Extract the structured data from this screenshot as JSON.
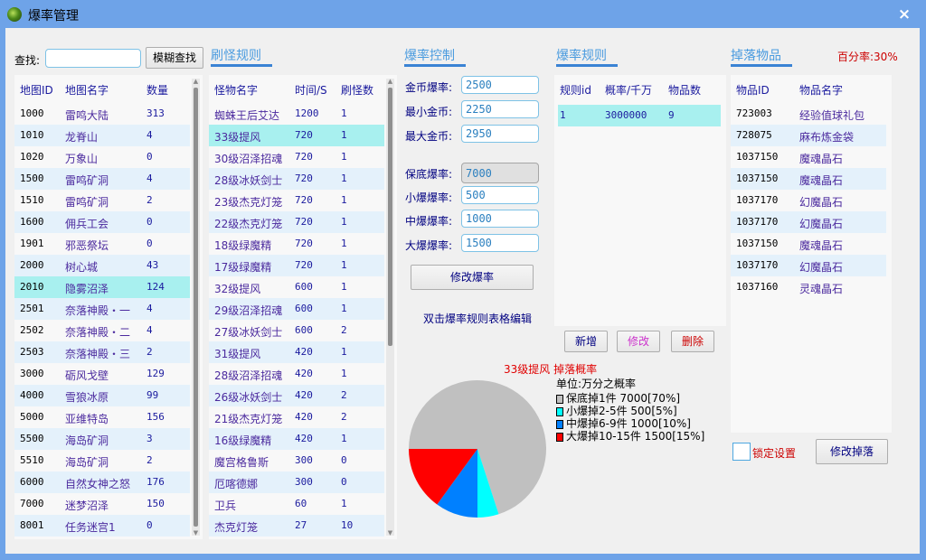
{
  "window": {
    "title": "爆率管理",
    "close_icon": "×"
  },
  "search": {
    "label": "查找:",
    "value": "",
    "placeholder": "",
    "button": "模糊查找"
  },
  "maps": {
    "columns": [
      "地图ID",
      "地图名字",
      "数量"
    ],
    "selected_index": 8,
    "rows": [
      {
        "id": "1000",
        "name": "雷鸣大陆",
        "count": "313"
      },
      {
        "id": "1010",
        "name": "龙脊山",
        "count": "4"
      },
      {
        "id": "1020",
        "name": "万象山",
        "count": "0"
      },
      {
        "id": "1500",
        "name": "雷鸣矿洞",
        "count": "4"
      },
      {
        "id": "1510",
        "name": "雷鸣矿洞",
        "count": "2"
      },
      {
        "id": "1600",
        "name": "佣兵工会",
        "count": "0"
      },
      {
        "id": "1901",
        "name": "邪恶祭坛",
        "count": "0"
      },
      {
        "id": "2000",
        "name": "树心城",
        "count": "43"
      },
      {
        "id": "2010",
        "name": "隐雾沼泽",
        "count": "124"
      },
      {
        "id": "2501",
        "name": "奈落神殿・一",
        "count": "4"
      },
      {
        "id": "2502",
        "name": "奈落神殿・二",
        "count": "4"
      },
      {
        "id": "2503",
        "name": "奈落神殿・三",
        "count": "2"
      },
      {
        "id": "3000",
        "name": "砺风戈壁",
        "count": "129"
      },
      {
        "id": "4000",
        "name": "雪狼冰原",
        "count": "99"
      },
      {
        "id": "5000",
        "name": "亚维特岛",
        "count": "156"
      },
      {
        "id": "5500",
        "name": "海岛矿洞",
        "count": "3"
      },
      {
        "id": "5510",
        "name": "海岛矿洞",
        "count": "2"
      },
      {
        "id": "6000",
        "name": "自然女神之怒",
        "count": "176"
      },
      {
        "id": "7000",
        "name": "迷梦沼泽",
        "count": "150"
      },
      {
        "id": "8001",
        "name": "任务迷宫1",
        "count": "0"
      }
    ]
  },
  "spawn_rules": {
    "title": "刷怪规则",
    "columns": [
      "怪物名字",
      "时间/S",
      "刷怪数"
    ],
    "selected_index": 1,
    "rows": [
      {
        "name": "蜘蛛王后艾达",
        "time": "1200",
        "count": "1"
      },
      {
        "name": "33级提风",
        "time": "720",
        "count": "1"
      },
      {
        "name": "30级沼泽招魂",
        "time": "720",
        "count": "1"
      },
      {
        "name": "28级冰妖剑士",
        "time": "720",
        "count": "1"
      },
      {
        "name": "23级杰克灯笼",
        "time": "720",
        "count": "1"
      },
      {
        "name": "22级杰克灯笼",
        "time": "720",
        "count": "1"
      },
      {
        "name": "18级绿魔精",
        "time": "720",
        "count": "1"
      },
      {
        "name": "17级绿魔精",
        "time": "720",
        "count": "1"
      },
      {
        "name": "32级提风",
        "time": "600",
        "count": "1"
      },
      {
        "name": "29级沼泽招魂",
        "time": "600",
        "count": "1"
      },
      {
        "name": "27级冰妖剑士",
        "time": "600",
        "count": "2"
      },
      {
        "name": "31级提风",
        "time": "420",
        "count": "1"
      },
      {
        "name": "28级沼泽招魂",
        "time": "420",
        "count": "1"
      },
      {
        "name": "26级冰妖剑士",
        "time": "420",
        "count": "2"
      },
      {
        "name": "21级杰克灯笼",
        "time": "420",
        "count": "2"
      },
      {
        "name": "16级绿魔精",
        "time": "420",
        "count": "1"
      },
      {
        "name": "魔宫格鲁斯",
        "time": "300",
        "count": "0"
      },
      {
        "name": "厄喀德娜",
        "time": "300",
        "count": "0"
      },
      {
        "name": "卫兵",
        "time": "60",
        "count": "1"
      },
      {
        "name": "杰克灯笼",
        "time": "27",
        "count": "10"
      }
    ]
  },
  "rate_control": {
    "title": "爆率控制",
    "fields": [
      {
        "label": "金币爆率:",
        "value": "2500",
        "disabled": false
      },
      {
        "label": "最小金币:",
        "value": "2250",
        "disabled": false
      },
      {
        "label": "最大金币:",
        "value": "2950",
        "disabled": false
      },
      {
        "label": "保底爆率:",
        "value": "7000",
        "disabled": true
      },
      {
        "label": "小爆爆率:",
        "value": "500",
        "disabled": false
      },
      {
        "label": "中爆爆率:",
        "value": "1000",
        "disabled": false
      },
      {
        "label": "大爆爆率:",
        "value": "1500",
        "disabled": false
      }
    ],
    "modify_button": "修改爆率",
    "hint": "双击爆率规则表格编辑"
  },
  "drop_rules": {
    "title": "爆率规则",
    "columns": [
      "规则id",
      "概率/千万",
      "物品数"
    ],
    "selected_index": 0,
    "rows": [
      {
        "id": "1",
        "rate": "3000000",
        "items": "9"
      }
    ],
    "buttons": {
      "add": "新增",
      "edit": "修改",
      "delete": "删除"
    },
    "button_colors": {
      "add": "#000080",
      "edit": "#cc33cc",
      "delete": "#cc0000"
    }
  },
  "drop_items": {
    "title": "掉落物品",
    "percent_label": "百分率:30%",
    "columns": [
      "物品ID",
      "物品名字"
    ],
    "rows": [
      {
        "id": "723003",
        "name": "经验值球礼包"
      },
      {
        "id": "728075",
        "name": "麻布炼金袋"
      },
      {
        "id": "1037150",
        "name": "魔魂晶石"
      },
      {
        "id": "1037150",
        "name": "魔魂晶石"
      },
      {
        "id": "1037170",
        "name": "幻魔晶石"
      },
      {
        "id": "1037170",
        "name": "幻魔晶石"
      },
      {
        "id": "1037150",
        "name": "魔魂晶石"
      },
      {
        "id": "1037170",
        "name": "幻魔晶石"
      },
      {
        "id": "1037160",
        "name": "灵魂晶石"
      }
    ],
    "lock_label": "锁定设置",
    "lock_checked": false,
    "modify_button": "修改掉落"
  },
  "chart_data": {
    "type": "pie",
    "title": "33级提风 掉落概率",
    "subtitle": "单位:万分之概率",
    "unit": "万分之概率",
    "slices": [
      {
        "label": "保底掉1件",
        "value": 7000,
        "percent": "70%",
        "color": "#c0c0c0",
        "legend": "保底掉1件  7000[70%]"
      },
      {
        "label": "小爆掉2-5件",
        "value": 500,
        "percent": "5%",
        "color": "#00ffff",
        "legend": "小爆掉2-5件  500[5%]"
      },
      {
        "label": "中爆掉6-9件",
        "value": 1000,
        "percent": "10%",
        "color": "#0080ff",
        "legend": "中爆掉6-9件  1000[10%]"
      },
      {
        "label": "大爆掉10-15件",
        "value": 1500,
        "percent": "15%",
        "color": "#ff0000",
        "legend": "大爆掉10-15件  1500[15%]"
      }
    ],
    "legend_position": "right"
  }
}
